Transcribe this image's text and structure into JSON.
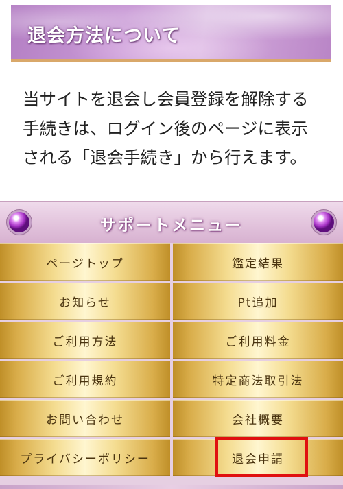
{
  "heading": {
    "title": "退会方法について"
  },
  "paragraph": {
    "lines": [
      "当サイトを退会し会員登録を解除する",
      "手続きは、ログイン後のページに表示",
      "される「退会手続き」から行えます。"
    ]
  },
  "menu": {
    "title": "サポートメニュー",
    "items": [
      {
        "label": "ページトップ"
      },
      {
        "label": "鑑定結果"
      },
      {
        "label": "お知らせ"
      },
      {
        "label": "Pt追加"
      },
      {
        "label": "ご利用方法"
      },
      {
        "label": "ご利用料金"
      },
      {
        "label": "ご利用規約"
      },
      {
        "label": "特定商法取引法"
      },
      {
        "label": "お問い合わせ"
      },
      {
        "label": "会社概要"
      },
      {
        "label": "プライバシーポリシー"
      },
      {
        "label": "退会申請"
      }
    ],
    "highlighted_item": "退会申請",
    "highlight_color": "#e01010"
  },
  "colors": {
    "banner_purple": "#c99ad6",
    "banner_underline": "#d9a86a",
    "menu_gold": "#f4dc90",
    "menu_text": "#4a3410"
  },
  "icons": [
    "purple-gem-icon",
    "purple-gem-icon"
  ]
}
